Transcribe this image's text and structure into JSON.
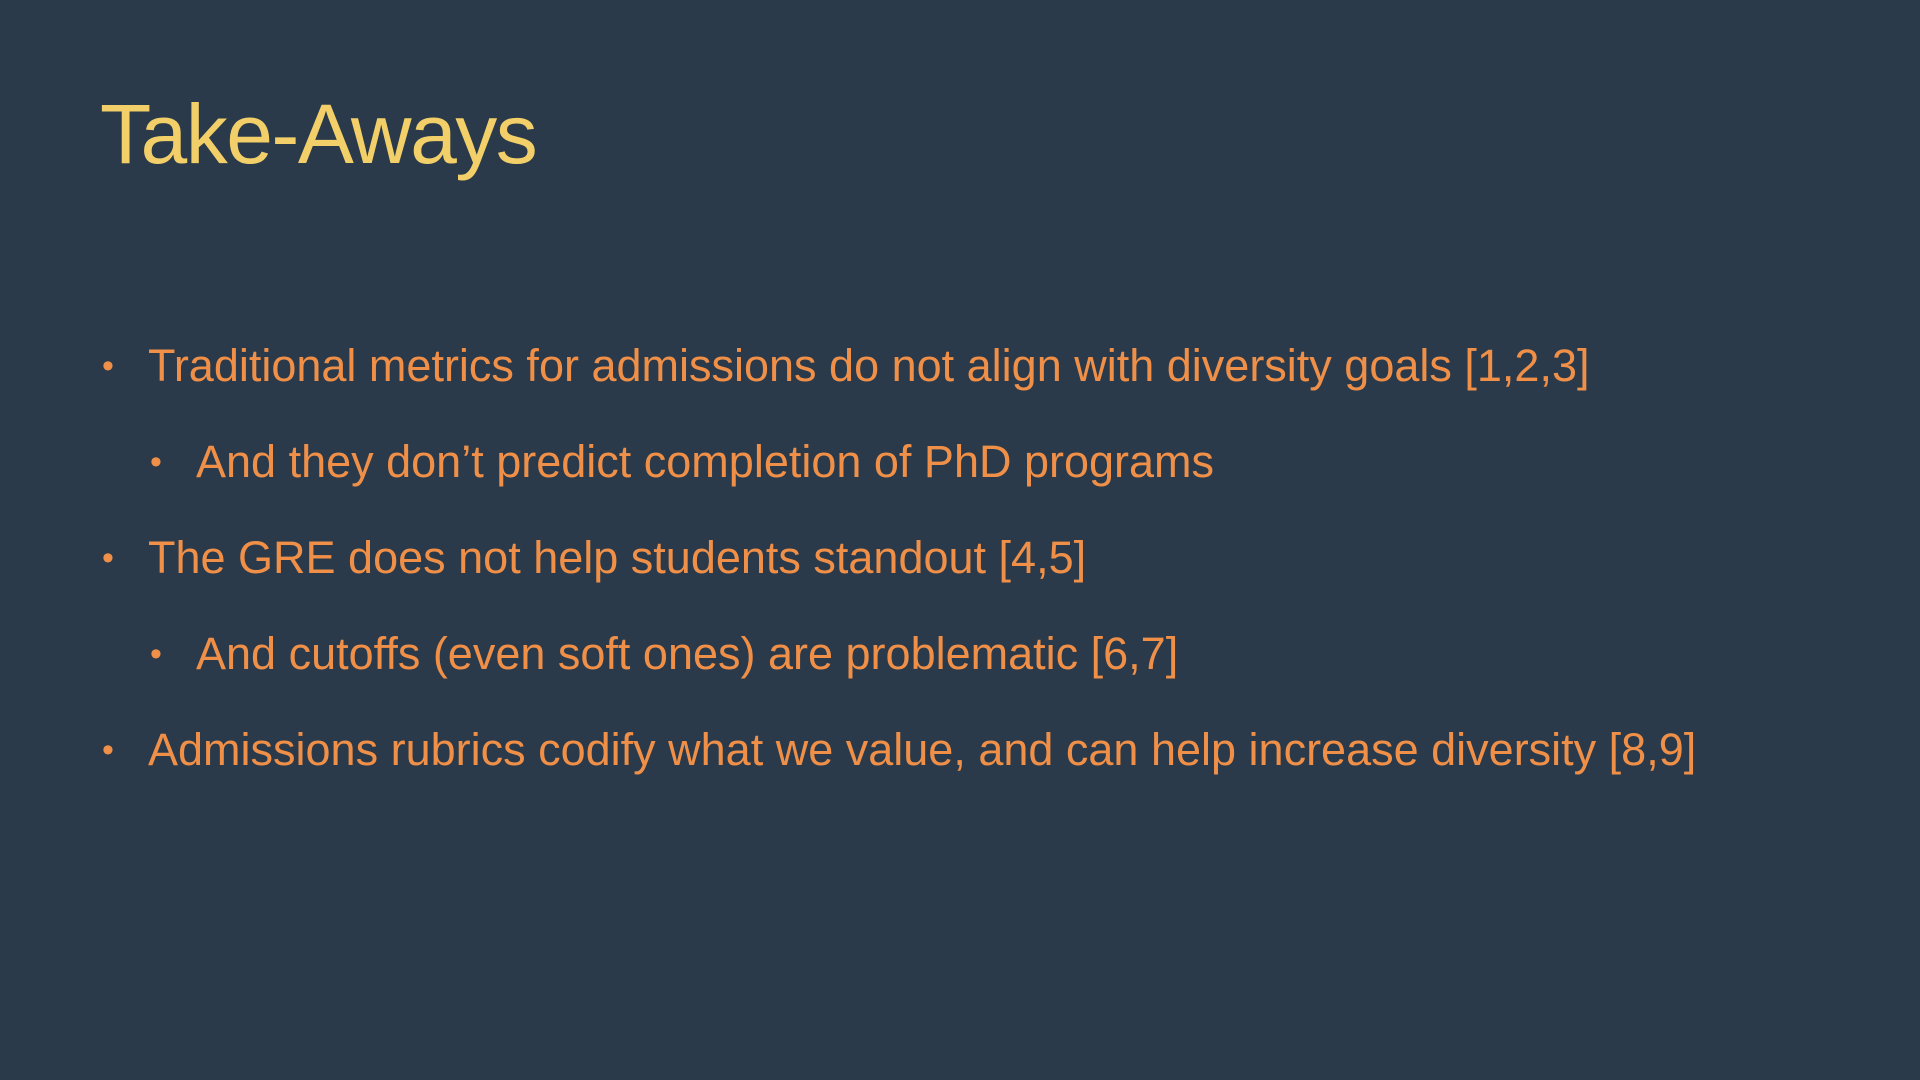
{
  "slide": {
    "title": "Take-Aways",
    "bullet_glyph": "•",
    "colors": {
      "background": "#2a3a4a",
      "title": "#f2cf68",
      "body": "#f09048"
    },
    "bullets": [
      {
        "level": 1,
        "text": "Traditional metrics for admissions do not align with diversity goals [1,2,3]"
      },
      {
        "level": 2,
        "text": "And they don’t predict completion of PhD programs"
      },
      {
        "level": 1,
        "text": "The GRE does not help students standout [4,5]"
      },
      {
        "level": 2,
        "text": "And cutoffs (even soft ones) are problematic [6,7]"
      },
      {
        "level": 1,
        "text": "Admissions rubrics codify what we value, and can help increase diversity [8,9]"
      }
    ]
  }
}
